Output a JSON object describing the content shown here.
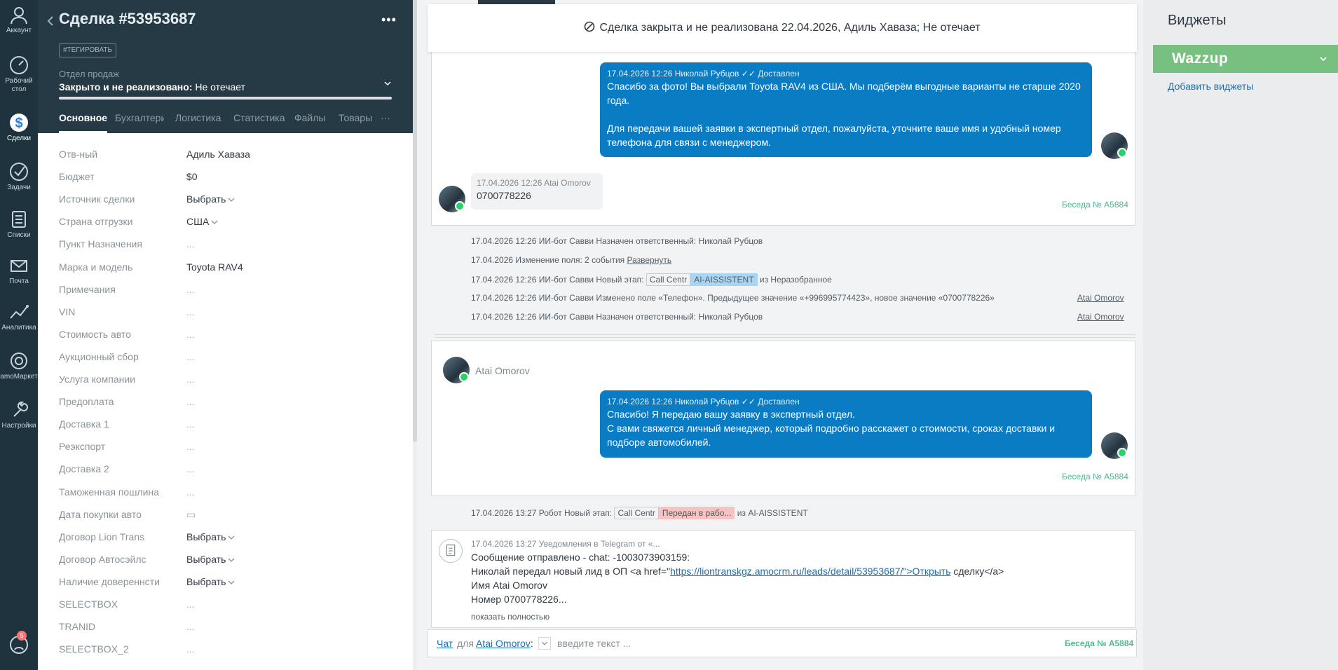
{
  "nav": {
    "items": [
      {
        "label": "Аккаунт",
        "icon": "account-icon"
      },
      {
        "label": "Рабочий стол",
        "icon": "dashboard-icon"
      },
      {
        "label": "Сделки",
        "icon": "deals-icon"
      },
      {
        "label": "Задачи",
        "icon": "tasks-icon"
      },
      {
        "label": "Списки",
        "icon": "lists-icon"
      },
      {
        "label": "Почта",
        "icon": "mail-icon"
      },
      {
        "label": "Аналитика",
        "icon": "analytics-icon"
      },
      {
        "label": "amoМаркет",
        "icon": "market-icon"
      },
      {
        "label": "Настройки",
        "icon": "settings-icon"
      }
    ],
    "chat_badge": "5"
  },
  "lead": {
    "title": "Сделка #53953687",
    "tag_button": "#ТЕГИРОВАТЬ",
    "pipeline": "Отдел продаж",
    "status_bold": "Закрыто и не реализовано:",
    "status_reason": "Не отечает",
    "tabs": [
      "Основное",
      "Бухгалтерия",
      "Логистика",
      "Статистика",
      "Файлы",
      "Товары"
    ],
    "tabs_more": "···",
    "fields": [
      {
        "label": "Отв-ный",
        "value": "Адиль Хаваза"
      },
      {
        "label": "Бюджет",
        "value": "$0"
      },
      {
        "label": "Источник сделки",
        "value": "Выбрать",
        "dropdown": true
      },
      {
        "label": "Страна отгрузки",
        "value": "США",
        "dropdown": true
      },
      {
        "label": "Пункт Назначения",
        "value": "..."
      },
      {
        "label": "Марка и модель",
        "value": "Toyota RAV4"
      },
      {
        "label": "Примечания",
        "value": "..."
      },
      {
        "label": "VIN",
        "value": "..."
      },
      {
        "label": "Стоимость авто",
        "value": "..."
      },
      {
        "label": "Аукционный сбор",
        "value": "..."
      },
      {
        "label": "Услуга компании",
        "value": "..."
      },
      {
        "label": "Предоплата",
        "value": "..."
      },
      {
        "label": "Доставка 1",
        "value": "..."
      },
      {
        "label": "Реэкспорт",
        "value": "..."
      },
      {
        "label": "Доставка 2",
        "value": "..."
      },
      {
        "label": "Таможенная пошлина",
        "value": "..."
      },
      {
        "label": "Дата покупки авто",
        "value": "▭"
      },
      {
        "label": "Договор Lion Trans",
        "value": "Выбрать",
        "dropdown": true
      },
      {
        "label": "Договор Автосэйлс",
        "value": "Выбрать",
        "dropdown": true
      },
      {
        "label": "Наличие довереннсти",
        "value": "Выбрать",
        "dropdown": true
      },
      {
        "label": "SELECTBOX",
        "value": "..."
      },
      {
        "label": "TRANID",
        "value": "..."
      },
      {
        "label": "SELECTBOX_2",
        "value": "..."
      }
    ]
  },
  "feed": {
    "closed_banner": "Сделка закрыта и не реализована 22.04.2026, Адиль Хаваза; Не отечает",
    "conv1": {
      "out_meta": "17.04.2026 12:26 Николай Рубцов ✓✓ Доставлен",
      "out_text_1": "Спасибо за фото! Вы выбрали Toyota RAV4 из США. Мы подберём выгодные варианты не старше 2020 года.",
      "out_text_2": "Для передачи вашей заявки в экспертный отдел, пожалуйста, уточните ваше имя и удобный номер телефона для связи с менеджером.",
      "in_meta": "17.04.2026 12:26 Atai Omorov",
      "in_text": "0700778226",
      "conv_no": "Беседа № A5884"
    },
    "events": [
      {
        "text": "17.04.2026 12:26 ИИ-бот Савви Назначен ответственный: Николай Рубцов"
      },
      {
        "text": "17.04.2026 Изменение поля: 2 события",
        "link": "Развернуть"
      },
      {
        "pre": "17.04.2026 12:26 ИИ-бот Савви Новый этап:",
        "pill1": "Call Centr",
        "pill2": "AI-AISSISTENT",
        "post": "из Неразобранное"
      },
      {
        "text": "17.04.2026 12:26 ИИ-бот Савви Изменено поле «Телефон». Предыдущее значение «+996995774423», новое значение «0700778226»",
        "right": "Atai Omorov"
      },
      {
        "text": "17.04.2026 12:26 ИИ-бот Савви Назначен ответственный: Николай Рубцов",
        "right": "Atai Omorov"
      }
    ],
    "conv2": {
      "contact": "Atai Omorov",
      "out_meta": "17.04.2026 12:26 Николай Рубцов ✓✓ Доставлен",
      "out_text_1": "Спасибо! Я передаю вашу заявку в экспертный отдел.",
      "out_text_2": "С вами свяжется личный менеджер, который подробно расскажет о стоимости, сроках доставки и подборе автомобилей.",
      "conv_no": "Беседа № A5884"
    },
    "event_stage": {
      "pre": "17.04.2026 13:27 Робот Новый этап:",
      "pill1": "Call Centr",
      "pill2": "Передан в рабо...",
      "post": "из AI-AISSISTENT"
    },
    "note": {
      "meta": "17.04.2026 13:27 Уведомления в Telegram от «...",
      "line1": "Сообщение отправлено - chat: -1003073903159:",
      "line2_pre": "Николай передал новый лид в ОП <a href=\"",
      "line2_link": "https://liontranskgz.amocrm.ru/leads/detail/53953687/\">Открыть",
      "line2_post": " сделку</a>",
      "line3": "Имя Atai Omorov",
      "line4": "Номер 0700778226...",
      "show_all": "показать полностью"
    },
    "chat_input": {
      "chat_word": "Чат",
      "for_word": "для",
      "contact": "Atai Omorov",
      "placeholder": "введите текст ...",
      "conv_no": "Беседа № A5884"
    }
  },
  "widgets": {
    "title": "Виджеты",
    "wazzup": "Wazzup",
    "add": "Добавить виджеты"
  },
  "colors": {
    "nav_bg": "#1e333e",
    "card_head_bg": "#263a45",
    "bubble_out": "#0a7cc4",
    "wazzup_green": "#78c07f",
    "conv_green": "#4fb98f"
  }
}
